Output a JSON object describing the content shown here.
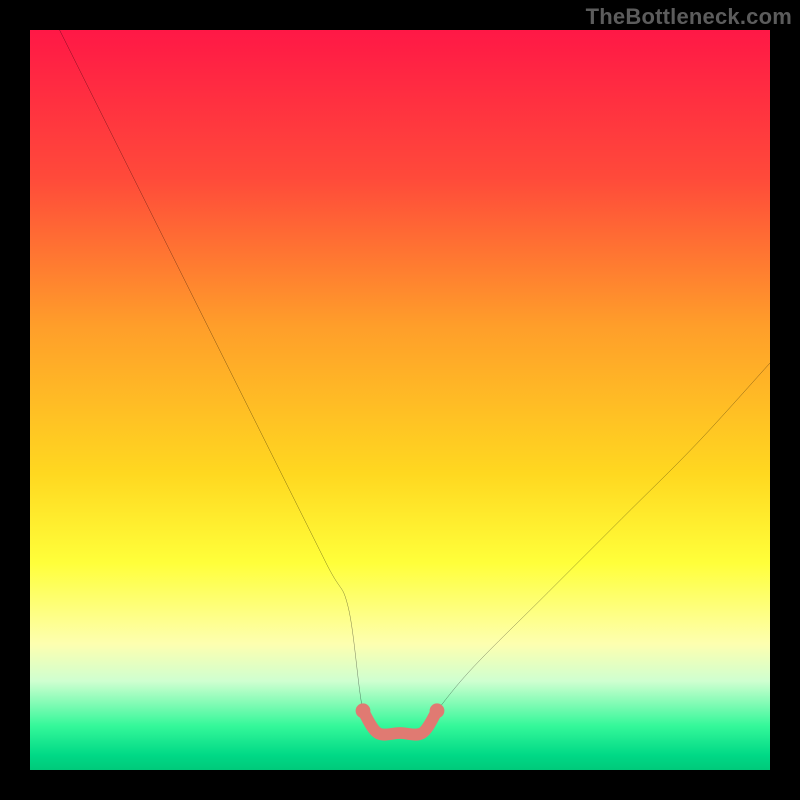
{
  "watermark": {
    "text": "TheBottleneck.com"
  },
  "chart_data": {
    "type": "line",
    "title": "",
    "xlabel": "",
    "ylabel": "",
    "xlim": [
      0,
      100
    ],
    "ylim": [
      0,
      100
    ],
    "x": [
      4,
      10,
      20,
      30,
      40,
      43,
      45,
      47,
      50,
      53,
      55,
      60,
      70,
      80,
      90,
      100
    ],
    "values": [
      100,
      88,
      68,
      48,
      28,
      22,
      8,
      5,
      5,
      5,
      8,
      14,
      24,
      34,
      44,
      55
    ],
    "highlight_band": {
      "x_start": 45,
      "x_end": 55,
      "color": "#e07a72"
    },
    "gradient_stops": [
      {
        "offset": 0.0,
        "color": "#ff1846"
      },
      {
        "offset": 0.2,
        "color": "#ff4a3a"
      },
      {
        "offset": 0.4,
        "color": "#ff9e2a"
      },
      {
        "offset": 0.6,
        "color": "#ffd820"
      },
      {
        "offset": 0.72,
        "color": "#ffff3a"
      },
      {
        "offset": 0.83,
        "color": "#fdffb0"
      },
      {
        "offset": 0.88,
        "color": "#cfffd0"
      },
      {
        "offset": 0.94,
        "color": "#35f89a"
      },
      {
        "offset": 0.98,
        "color": "#00d986"
      },
      {
        "offset": 1.0,
        "color": "#00c97a"
      }
    ]
  }
}
